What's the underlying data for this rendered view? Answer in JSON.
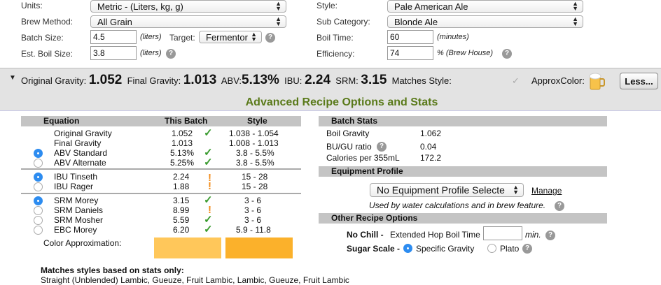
{
  "form": {
    "units": {
      "label": "Units:",
      "value": "Metric - (Liters, kg, g)"
    },
    "brew_method": {
      "label": "Brew Method:",
      "value": "All Grain"
    },
    "batch_size": {
      "label": "Batch Size:",
      "value": "4.5",
      "unit": "(liters)",
      "target_label": "Target:",
      "target_value": "Fermentor"
    },
    "boil_size": {
      "label": "Est. Boil Size:",
      "value": "3.8",
      "unit": "(liters)"
    },
    "style": {
      "label": "Style:",
      "value": "Pale American Ale"
    },
    "sub_category": {
      "label": "Sub Category:",
      "value": "Blonde Ale"
    },
    "boil_time": {
      "label": "Boil Time:",
      "value": "60",
      "unit": "(minutes)"
    },
    "efficiency": {
      "label": "Efficiency:",
      "value": "74",
      "unit": "% (Brew House)"
    }
  },
  "summary": {
    "og_label": "Original Gravity:",
    "og": "1.052",
    "fg_label": "Final Gravity:",
    "fg": "1.013",
    "abv_label": "ABV:",
    "abv": "5.13%",
    "ibu_label": "IBU:",
    "ibu": "2.24",
    "srm_label": "SRM:",
    "srm": "3.15",
    "matches_label": "Matches Style:",
    "approx_label": "ApproxColor:",
    "less_button": "Less..."
  },
  "advanced": {
    "title": "Advanced Recipe Options and Stats",
    "table_headers": {
      "equation": "Equation",
      "batch": "This Batch",
      "style": "Style"
    },
    "rows": [
      {
        "name": "Original Gravity",
        "batch": "1.052",
        "style": "1.038 - 1.054"
      },
      {
        "name": "Final Gravity",
        "batch": "1.013",
        "style": "1.008 - 1.013"
      },
      {
        "name": "ABV Standard",
        "batch": "5.13%",
        "style": "3.8 - 5.5%"
      },
      {
        "name": "ABV Alternate",
        "batch": "5.25%",
        "style": "3.8 - 5.5%"
      },
      {
        "name": "IBU Tinseth",
        "batch": "2.24",
        "style": "15 - 28"
      },
      {
        "name": "IBU Rager",
        "batch": "1.88",
        "style": "15 - 28"
      },
      {
        "name": "SRM Morey",
        "batch": "3.15",
        "style": "3 - 6"
      },
      {
        "name": "SRM Daniels",
        "batch": "8.99",
        "style": "3 - 6"
      },
      {
        "name": "SRM Mosher",
        "batch": "5.59",
        "style": "3 - 6"
      },
      {
        "name": "EBC Morey",
        "batch": "6.20",
        "style": "5.9 - 11.8"
      }
    ],
    "color_approx_label": "Color Approximation:",
    "color_batch": "#ffc75a",
    "color_style": "#fbb12b",
    "matches_title": "Matches styles based on stats only:",
    "matches_text": "Straight (Unblended) Lambic, Gueuze, Fruit Lambic, Lambic, Gueuze, Fruit Lambic"
  },
  "batch_stats": {
    "header": "Batch Stats",
    "boil_gravity_label": "Boil Gravity",
    "boil_gravity": "1.062",
    "bugu_label": "BU/GU ratio",
    "bugu": "0.04",
    "calories_label": "Calories per 355mL",
    "calories": "172.2"
  },
  "equipment": {
    "header": "Equipment Profile",
    "select_value": "No Equipment Profile Selecte",
    "manage": "Manage",
    "note": "Used by water calculations and in brew feature."
  },
  "other": {
    "header": "Other Recipe Options",
    "no_chill_label": "No Chill -",
    "hop_boil_label": "Extended Hop Boil Time",
    "hop_boil_value": "",
    "min_label": "min.",
    "sugar_label": "Sugar Scale -",
    "sg_label": "Specific Gravity",
    "plato_label": "Plato"
  },
  "icons": {
    "help": "?",
    "check": "✓",
    "warn": "!"
  }
}
